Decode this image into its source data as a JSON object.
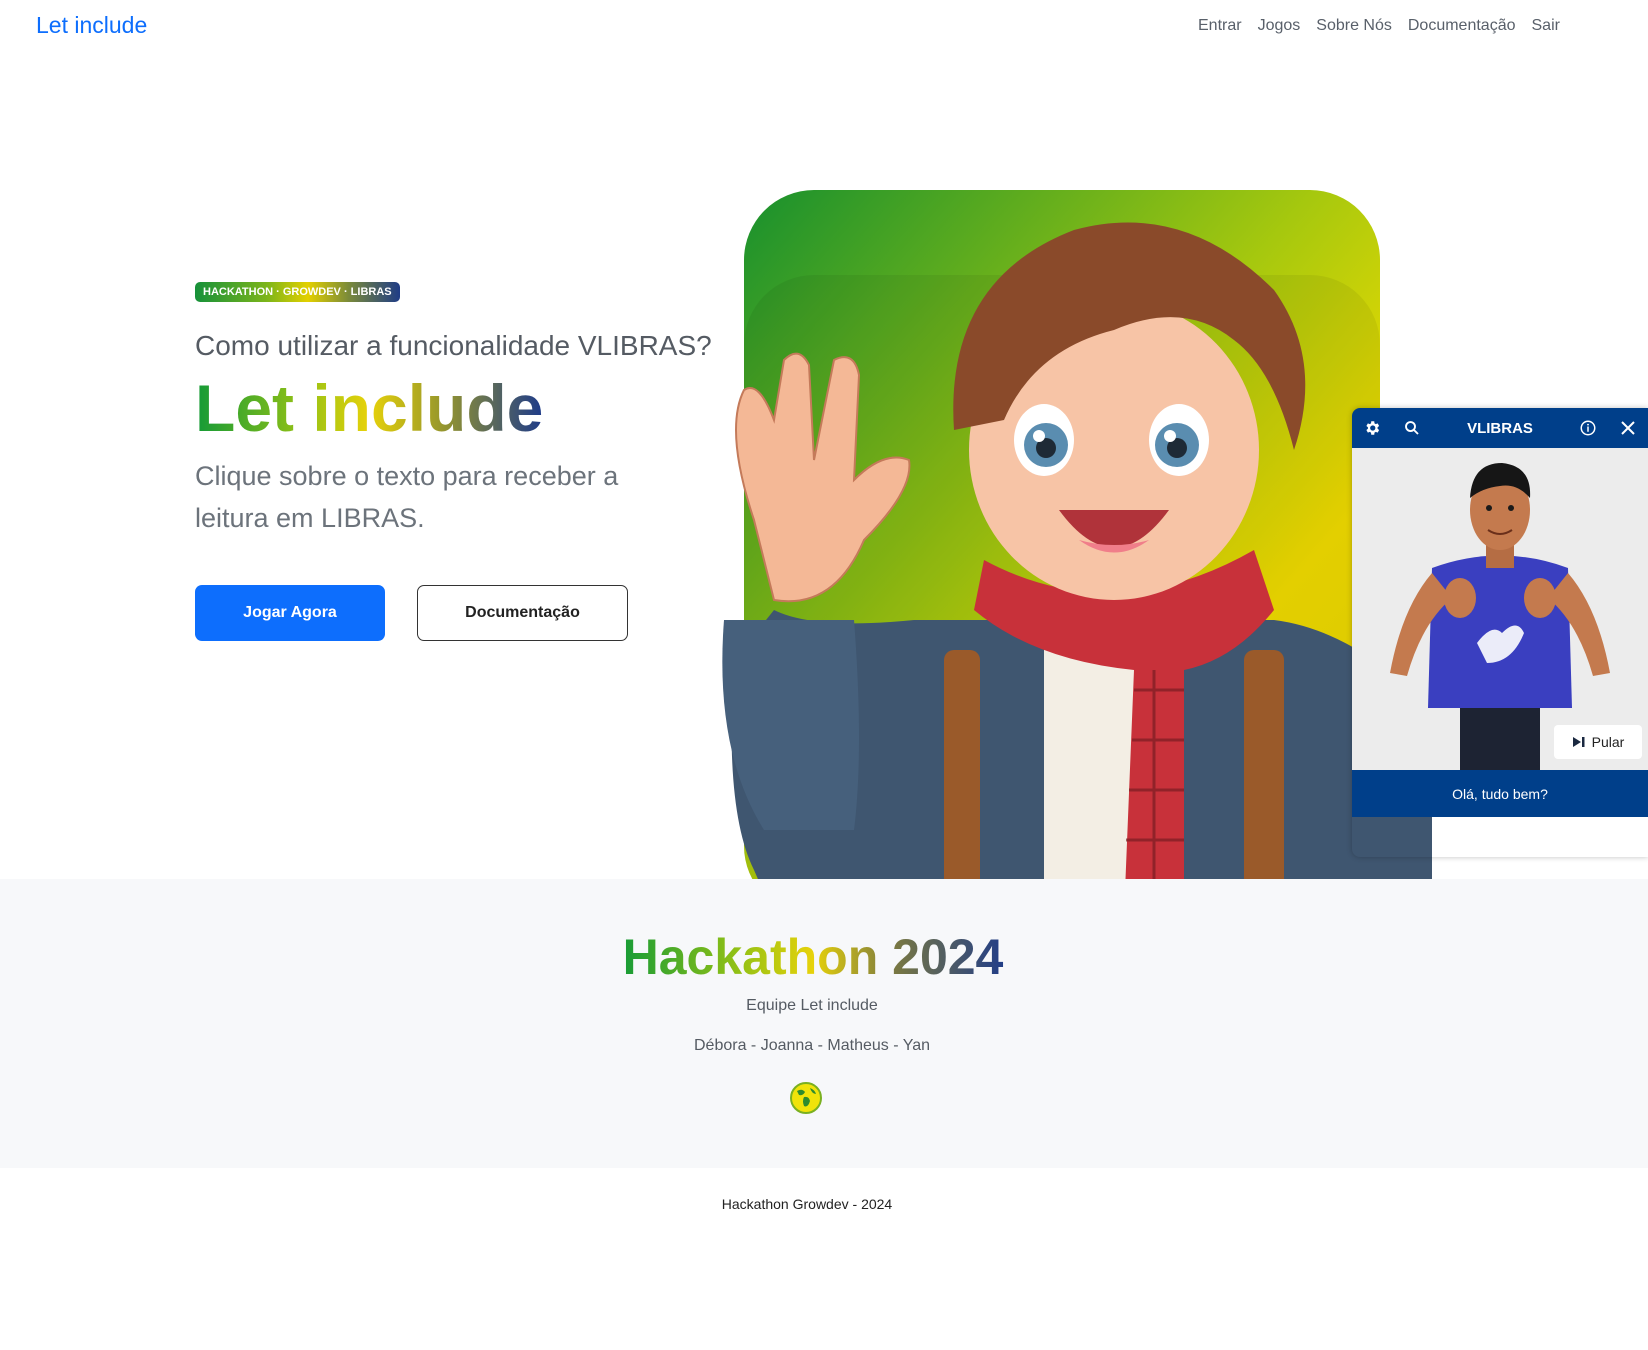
{
  "navbar": {
    "brand": "Let include",
    "links": [
      "Entrar",
      "Jogos",
      "Sobre Nós",
      "Documentação",
      "Sair"
    ]
  },
  "hero": {
    "badge": "HACKATHON · GROWDEV · LIBRAS",
    "question": "Como utilizar a funcionalidade VLIBRAS?",
    "title": "Let include",
    "lead": "Clique sobre o texto para receber a leitura em LIBRAS.",
    "primary_button": "Jogar Agora",
    "secondary_button": "Documentação",
    "image_icon": "waving-boy-illustration"
  },
  "team_section": {
    "title": "Hackathon 2024",
    "team": "Equipe Let include",
    "members": "Débora - Joanna - Matheus - Yan",
    "icon": "globe-icon"
  },
  "footer": {
    "copyright": "Hackathon Growdev - 2024"
  },
  "vlibras": {
    "title": "VLIBRAS",
    "skip_label": "Pular",
    "caption": "Olá, tudo bem?",
    "colors": {
      "header": "#003f8a",
      "avatar_shirt": "#3a3fc0"
    }
  }
}
